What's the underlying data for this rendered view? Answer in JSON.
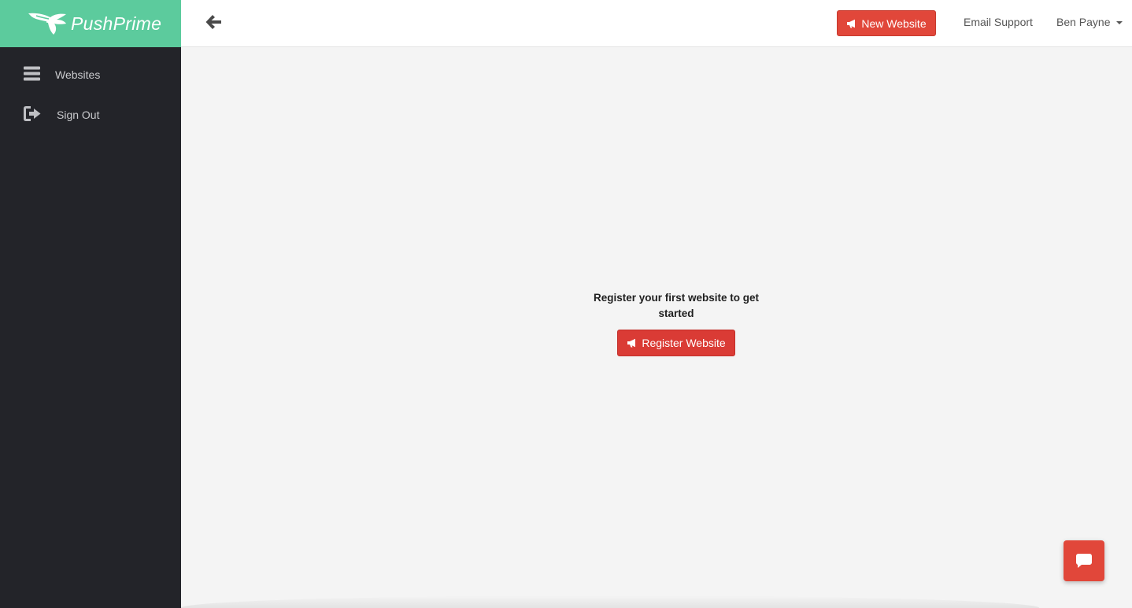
{
  "brand": {
    "name": "PushPrime",
    "color": "#5ccb9d",
    "icon": "winged-bird-logo-icon"
  },
  "sidebar": {
    "items": [
      {
        "label": "Websites",
        "icon": "menu-bars-icon"
      },
      {
        "label": "Sign Out",
        "icon": "sign-out-icon"
      }
    ]
  },
  "header": {
    "back_icon": "arrow-left-icon",
    "new_website_label": "New Website",
    "new_website_icon": "megaphone-icon",
    "email_support_label": "Email Support",
    "user_name": "Ben Payne",
    "user_menu_icon": "caret-down-icon"
  },
  "main": {
    "empty_message": "Register your first website to get started",
    "register_button_label": "Register Website",
    "register_button_icon": "megaphone-icon"
  },
  "chat_widget": {
    "icon": "chat-bubble-icon"
  },
  "colors": {
    "accent_red": "#e1473a",
    "sidebar_bg": "#232429",
    "content_bg": "#f4f4f4"
  }
}
